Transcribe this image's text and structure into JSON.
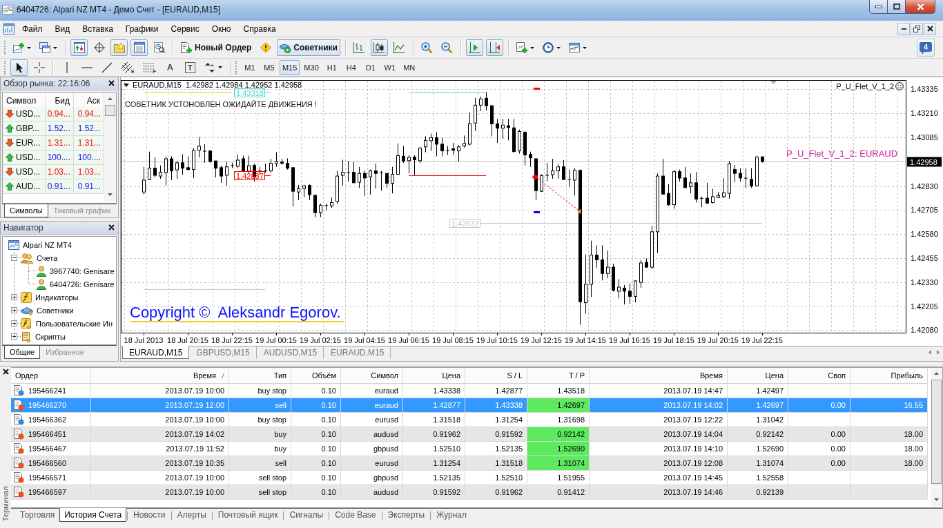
{
  "window": {
    "title": "6404726: Alpari NZ MT4 - Демо Счет - [EURAUD,M15]"
  },
  "menu": [
    "Файл",
    "Вид",
    "Вставка",
    "Графики",
    "Сервис",
    "Окно",
    "Справка"
  ],
  "toolbar": {
    "groups": [
      [
        {
          "kind": "new-chart",
          "pressed": false
        },
        {
          "kind": "profiles",
          "pressed": false
        }
      ],
      [
        {
          "kind": "market-watch",
          "pressed": true
        },
        {
          "kind": "data-window",
          "pressed": false
        },
        {
          "kind": "navigator",
          "pressed": true
        },
        {
          "kind": "terminal",
          "pressed": true
        },
        {
          "kind": "tester",
          "pressed": false
        }
      ],
      [
        {
          "kind": "new-order",
          "label": "Новый Ордер",
          "pressed": false
        },
        {
          "kind": "alert",
          "pressed": false
        },
        {
          "kind": "experts",
          "label": "Советники",
          "pressed": true
        }
      ],
      [
        {
          "kind": "bar-chart",
          "pressed": false
        },
        {
          "kind": "candle-chart",
          "pressed": true
        },
        {
          "kind": "line-chart",
          "pressed": false
        }
      ],
      [
        {
          "kind": "zoom-in",
          "pressed": false
        },
        {
          "kind": "zoom-out",
          "pressed": false
        }
      ],
      [
        {
          "kind": "auto-scroll",
          "pressed": true
        },
        {
          "kind": "chart-shift",
          "pressed": true
        }
      ],
      [
        {
          "kind": "indicators",
          "pressed": false
        },
        {
          "kind": "periods",
          "pressed": false
        },
        {
          "kind": "templates",
          "pressed": false
        }
      ]
    ],
    "notifications": "4"
  },
  "drawing_tools": {
    "groups": [
      [
        {
          "kind": "cursor",
          "pressed": true
        },
        {
          "kind": "crosshair",
          "pressed": false
        }
      ],
      [
        {
          "kind": "vline",
          "pressed": false
        },
        {
          "kind": "hline",
          "pressed": false
        },
        {
          "kind": "trendline",
          "pressed": false
        },
        {
          "kind": "channel",
          "label": "E",
          "pressed": false
        },
        {
          "kind": "fibo",
          "label": "F",
          "pressed": false
        },
        {
          "kind": "text",
          "label": "A",
          "pressed": false
        },
        {
          "kind": "text-label",
          "label": "T",
          "pressed": false
        },
        {
          "kind": "arrows",
          "pressed": false
        }
      ]
    ]
  },
  "timeframes": [
    {
      "label": "M1",
      "selected": false
    },
    {
      "label": "M5",
      "selected": false
    },
    {
      "label": "M15",
      "selected": true
    },
    {
      "label": "M30",
      "selected": false
    },
    {
      "label": "H1",
      "selected": false
    },
    {
      "label": "H4",
      "selected": false
    },
    {
      "label": "D1",
      "selected": false
    },
    {
      "label": "W1",
      "selected": false
    },
    {
      "label": "MN",
      "selected": false
    }
  ],
  "market_watch": {
    "title": "Обзор рынка: 22:16:06",
    "columns": [
      "Символ",
      "Бид",
      "Аск"
    ],
    "rows": [
      {
        "symbol": "USD...",
        "bid": "0.94...",
        "ask": "0.94...",
        "up": false
      },
      {
        "symbol": "GBP...",
        "bid": "1.52...",
        "ask": "1.52...",
        "up": true
      },
      {
        "symbol": "EUR...",
        "bid": "1.31...",
        "ask": "1.31...",
        "up": false
      },
      {
        "symbol": "USD...",
        "bid": "100....",
        "ask": "100....",
        "up": true
      },
      {
        "symbol": "USD...",
        "bid": "1.03...",
        "ask": "1.03...",
        "up": false
      },
      {
        "symbol": "AUD...",
        "bid": "0.91...",
        "ask": "0.91...",
        "up": true
      }
    ],
    "tabs": [
      {
        "label": "Символы",
        "selected": true
      },
      {
        "label": "Тиковый график",
        "selected": false
      }
    ]
  },
  "navigator": {
    "title": "Навигатор",
    "tree": [
      {
        "label": "Alpari NZ MT4",
        "kind": "terminal",
        "children": [
          {
            "label": "Счета",
            "kind": "accounts",
            "expanded": true,
            "children": [
              {
                "label": "3967740: Genisare",
                "kind": "account"
              },
              {
                "label": "6404726: Genisare",
                "kind": "account"
              }
            ]
          },
          {
            "label": "Индикаторы",
            "kind": "indicators",
            "expanded": false
          },
          {
            "label": "Советники",
            "kind": "experts",
            "expanded": false
          },
          {
            "label": "Пользовательские Ин",
            "kind": "custom-indicators",
            "expanded": false
          },
          {
            "label": "Скрипты",
            "kind": "scripts",
            "expanded": false
          }
        ]
      }
    ],
    "tabs": [
      {
        "label": "Общие",
        "selected": true
      },
      {
        "label": "Избранное",
        "selected": false
      }
    ]
  },
  "chart": {
    "header": "EURAUD,M15  1.42982 1.42984 1.42952 1.42958",
    "message": "СОВЕТНИК УСТОНОВЛЕН ОЖИДАЙТЕ ДВИЖЕНИЯ !",
    "expert": "P_U_Flet_V_1_2",
    "symbol_label": "P_U_Flet_V_1_2: EURAUD",
    "copyright": "Copyright ©  Aleksandr Egorov.",
    "chart_data": [
      {
        "type": "candlestick",
        "grid": true,
        "xlim": [
          "2013-07-18T17:15",
          "2013-07-20T04:45"
        ],
        "ylim": [
          1.42067,
          1.43378
        ],
        "x": [
          "2013-07-18T18:15",
          "2013-07-18T18:30",
          "2013-07-18T18:45",
          "2013-07-18T19:00",
          "2013-07-18T19:15",
          "2013-07-18T19:30",
          "2013-07-18T19:45",
          "2013-07-18T20:00",
          "2013-07-18T20:15",
          "2013-07-18T20:30",
          "2013-07-18T20:45",
          "2013-07-18T21:00",
          "2013-07-18T21:15",
          "2013-07-18T21:30",
          "2013-07-18T21:45",
          "2013-07-18T22:00",
          "2013-07-18T22:15",
          "2013-07-18T22:30",
          "2013-07-18T22:45",
          "2013-07-18T23:00",
          "2013-07-18T23:15",
          "2013-07-18T23:30",
          "2013-07-18T23:45",
          "2013-07-19T00:00",
          "2013-07-19T00:15",
          "2013-07-19T00:30",
          "2013-07-19T00:45",
          "2013-07-19T01:00",
          "2013-07-19T01:15",
          "2013-07-19T01:30",
          "2013-07-19T01:45",
          "2013-07-19T02:00",
          "2013-07-19T02:15",
          "2013-07-19T02:30",
          "2013-07-19T02:45",
          "2013-07-19T03:00",
          "2013-07-19T03:15",
          "2013-07-19T03:30",
          "2013-07-19T03:45",
          "2013-07-19T04:00",
          "2013-07-19T04:15",
          "2013-07-19T04:30",
          "2013-07-19T04:45",
          "2013-07-19T05:00",
          "2013-07-19T05:15",
          "2013-07-19T05:30",
          "2013-07-19T05:45",
          "2013-07-19T06:00",
          "2013-07-19T06:15",
          "2013-07-19T06:30",
          "2013-07-19T06:45",
          "2013-07-19T07:00",
          "2013-07-19T07:15",
          "2013-07-19T07:30",
          "2013-07-19T07:45",
          "2013-07-19T08:00",
          "2013-07-19T08:15",
          "2013-07-19T08:30",
          "2013-07-19T08:45",
          "2013-07-19T09:00",
          "2013-07-19T09:15",
          "2013-07-19T09:30",
          "2013-07-19T09:45",
          "2013-07-19T10:00",
          "2013-07-19T10:15",
          "2013-07-19T10:30",
          "2013-07-19T10:45",
          "2013-07-19T11:00",
          "2013-07-19T11:15",
          "2013-07-19T11:30",
          "2013-07-19T11:45",
          "2013-07-19T12:00",
          "2013-07-19T12:15",
          "2013-07-19T12:30",
          "2013-07-19T12:45",
          "2013-07-19T13:00",
          "2013-07-19T13:15",
          "2013-07-19T13:30",
          "2013-07-19T13:45",
          "2013-07-19T14:00",
          "2013-07-19T14:15",
          "2013-07-19T14:30",
          "2013-07-19T14:45",
          "2013-07-19T15:00",
          "2013-07-19T15:15",
          "2013-07-19T15:30",
          "2013-07-19T15:45",
          "2013-07-19T16:00",
          "2013-07-19T16:15",
          "2013-07-19T16:30",
          "2013-07-19T16:45",
          "2013-07-19T17:00",
          "2013-07-19T17:15",
          "2013-07-19T17:30",
          "2013-07-19T17:45",
          "2013-07-19T18:00",
          "2013-07-19T18:15",
          "2013-07-19T18:30",
          "2013-07-19T18:45",
          "2013-07-19T19:00",
          "2013-07-19T19:15",
          "2013-07-19T19:30",
          "2013-07-19T19:45",
          "2013-07-19T20:00",
          "2013-07-19T20:15",
          "2013-07-19T20:30",
          "2013-07-19T20:45",
          "2013-07-19T21:00",
          "2013-07-19T21:15",
          "2013-07-19T21:30",
          "2013-07-19T21:45",
          "2013-07-19T22:00",
          "2013-07-19T22:15"
        ],
        "ohlc": [
          [
            1.42799,
            1.4293,
            1.42785,
            1.42861
          ],
          [
            1.42864,
            1.43009,
            1.42861,
            1.42923
          ],
          [
            1.42923,
            1.42979,
            1.42875,
            1.42886
          ],
          [
            1.42882,
            1.42937,
            1.42868,
            1.42902
          ],
          [
            1.429,
            1.42985,
            1.42833,
            1.42972
          ],
          [
            1.42972,
            1.42985,
            1.42861,
            1.42909
          ],
          [
            1.42914,
            1.42958,
            1.42868,
            1.42951
          ],
          [
            1.42951,
            1.42995,
            1.42889,
            1.42923
          ],
          [
            1.42926,
            1.42985,
            1.42909,
            1.42916
          ],
          [
            1.42916,
            1.43027,
            1.42871,
            1.43017
          ],
          [
            1.43017,
            1.43085,
            1.42979,
            1.43037
          ],
          [
            1.43013,
            1.43048,
            1.42951,
            1.4301
          ],
          [
            1.43013,
            1.43013,
            1.42951,
            1.42958
          ],
          [
            1.42961,
            1.42961,
            1.42875,
            1.42923
          ],
          [
            1.42926,
            1.42937,
            1.42847,
            1.42882
          ],
          [
            1.42886,
            1.42955,
            1.42833,
            1.4293
          ],
          [
            1.42937,
            1.42951,
            1.42923,
            1.42935
          ],
          [
            1.42933,
            1.42995,
            1.42923,
            1.42965
          ],
          [
            1.42972,
            1.42988,
            1.42902,
            1.42909
          ],
          [
            1.42908,
            1.42988,
            1.42896,
            1.42936
          ],
          [
            1.42937,
            1.42947,
            1.42854,
            1.42878
          ],
          [
            1.42909,
            1.4293,
            1.42889,
            1.42907
          ],
          [
            1.42907,
            1.42947,
            1.429,
            1.42909
          ],
          [
            1.42909,
            1.42972,
            1.429,
            1.42948
          ],
          [
            1.42947,
            1.43006,
            1.4293,
            1.42958
          ],
          [
            1.42955,
            1.42972,
            1.42941,
            1.42949
          ],
          [
            1.42948,
            1.42974,
            1.42916,
            1.42923
          ],
          [
            1.42926,
            1.42926,
            1.42723,
            1.42803
          ],
          [
            1.42799,
            1.42836,
            1.42757,
            1.42817
          ],
          [
            1.42817,
            1.42836,
            1.42771,
            1.42831
          ],
          [
            1.42833,
            1.4284,
            1.42757,
            1.42785
          ],
          [
            1.42782,
            1.42782,
            1.42668,
            1.42692
          ],
          [
            1.42692,
            1.42739,
            1.42668,
            1.4273
          ],
          [
            1.42727,
            1.42739,
            1.42702,
            1.4273
          ],
          [
            1.42727,
            1.42771,
            1.42716,
            1.42744
          ],
          [
            1.4275,
            1.42909,
            1.42739,
            1.42882
          ],
          [
            1.42886,
            1.42967,
            1.42833,
            1.42902
          ],
          [
            1.429,
            1.42961,
            1.42854,
            1.42902
          ],
          [
            1.42902,
            1.42955,
            1.42847,
            1.42847
          ],
          [
            1.4285,
            1.4293,
            1.4282,
            1.42896
          ],
          [
            1.42896,
            1.42909,
            1.42778,
            1.42872
          ],
          [
            1.42878,
            1.42916,
            1.42785,
            1.42909
          ],
          [
            1.42909,
            1.42947,
            1.42817,
            1.42896
          ],
          [
            1.429,
            1.42909,
            1.42806,
            1.42898
          ],
          [
            1.42896,
            1.42896,
            1.4282,
            1.42844
          ],
          [
            1.42844,
            1.4293,
            1.42792,
            1.42891
          ],
          [
            1.42891,
            1.43052,
            1.42889,
            1.42988
          ],
          [
            1.42985,
            1.43038,
            1.42951,
            1.42961
          ],
          [
            1.42962,
            1.42992,
            1.42896,
            1.42979
          ],
          [
            1.42981,
            1.4299,
            1.42886,
            1.42967
          ],
          [
            1.42962,
            1.43034,
            1.42951,
            1.43027
          ],
          [
            1.43034,
            1.43089,
            1.43006,
            1.43068
          ],
          [
            1.43066,
            1.43103,
            1.43013,
            1.43082
          ],
          [
            1.43082,
            1.4311,
            1.42985,
            1.43048
          ],
          [
            1.43048,
            1.43082,
            1.42985,
            1.43013
          ],
          [
            1.43017,
            1.43038,
            1.42992,
            1.43015
          ],
          [
            1.43024,
            1.43055,
            1.42992,
            1.43016
          ],
          [
            1.43013,
            1.43043,
            1.42958,
            1.43034
          ],
          [
            1.43038,
            1.43093,
            1.4303,
            1.43052
          ],
          [
            1.43048,
            1.43213,
            1.43041,
            1.43155
          ],
          [
            1.43158,
            1.43289,
            1.43117,
            1.43251
          ],
          [
            1.43251,
            1.43296,
            1.4322,
            1.43283
          ],
          [
            1.43287,
            1.43318,
            1.43223,
            1.43248
          ],
          [
            1.43248,
            1.43251,
            1.43089,
            1.43154
          ],
          [
            1.43154,
            1.43179,
            1.43055,
            1.43131
          ],
          [
            1.43131,
            1.43179,
            1.43075,
            1.43147
          ],
          [
            1.43144,
            1.43179,
            1.43068,
            1.43135
          ],
          [
            1.43133,
            1.43179,
            1.43006,
            1.43009
          ],
          [
            1.43013,
            1.43124,
            1.42999,
            1.43114
          ],
          [
            1.4311,
            1.43117,
            1.42937,
            1.42992
          ],
          [
            1.42995,
            1.43009,
            1.4293,
            1.42977
          ],
          [
            1.42972,
            1.42974,
            1.42757,
            1.42806
          ],
          [
            1.42803,
            1.42891,
            1.42799,
            1.42885
          ],
          [
            1.42885,
            1.42951,
            1.42854,
            1.42887
          ],
          [
            1.42889,
            1.42972,
            1.42868,
            1.42909
          ],
          [
            1.42909,
            1.42944,
            1.42868,
            1.4293
          ],
          [
            1.4293,
            1.42965,
            1.42861,
            1.42864
          ],
          [
            1.42864,
            1.42916,
            1.42827,
            1.42866
          ],
          [
            1.42861,
            1.42923,
            1.42781,
            1.42912
          ],
          [
            1.42912,
            1.42916,
            1.42108,
            1.42228
          ],
          [
            1.42223,
            1.42474,
            1.42166,
            1.42319
          ],
          [
            1.42319,
            1.42546,
            1.42253,
            1.42471
          ],
          [
            1.42471,
            1.42522,
            1.42405,
            1.42446
          ],
          [
            1.42446,
            1.42522,
            1.42339,
            1.42375
          ],
          [
            1.42375,
            1.42495,
            1.4235,
            1.42408
          ],
          [
            1.42408,
            1.42426,
            1.42281,
            1.42288
          ],
          [
            1.42283,
            1.42346,
            1.42246,
            1.42304
          ],
          [
            1.42299,
            1.42315,
            1.42214,
            1.42283
          ],
          [
            1.42283,
            1.42322,
            1.42218,
            1.42256
          ],
          [
            1.42256,
            1.42339,
            1.42225,
            1.42336
          ],
          [
            1.42329,
            1.42446,
            1.42301,
            1.4243
          ],
          [
            1.42433,
            1.42453,
            1.42405,
            1.42408
          ],
          [
            1.42408,
            1.42623,
            1.42398,
            1.42592
          ],
          [
            1.42592,
            1.42896,
            1.42481,
            1.42882
          ],
          [
            1.42882,
            1.42972,
            1.42788,
            1.42788
          ],
          [
            1.42792,
            1.4284,
            1.42727,
            1.42733
          ],
          [
            1.42733,
            1.42914,
            1.42712,
            1.42905
          ],
          [
            1.42905,
            1.42916,
            1.42854,
            1.42872
          ],
          [
            1.42872,
            1.4293,
            1.4282,
            1.42822
          ],
          [
            1.42827,
            1.42896,
            1.42792,
            1.42847
          ],
          [
            1.42847,
            1.42902,
            1.42744,
            1.42762
          ],
          [
            1.42767,
            1.42775,
            1.4272,
            1.42765
          ],
          [
            1.42767,
            1.42847,
            1.42737,
            1.42741
          ],
          [
            1.42744,
            1.42815,
            1.42739,
            1.42775
          ],
          [
            1.42771,
            1.42799,
            1.42767,
            1.42781
          ],
          [
            1.42775,
            1.42872,
            1.42767,
            1.42795
          ],
          [
            1.42792,
            1.42961,
            1.42764,
            1.42947
          ],
          [
            1.42916,
            1.4294,
            1.4285,
            1.42896
          ],
          [
            1.42896,
            1.42923,
            1.42854,
            1.42872
          ],
          [
            1.42872,
            1.42923,
            1.4282,
            1.4287
          ],
          [
            1.42865,
            1.42923,
            1.4282,
            1.42831
          ],
          [
            1.42831,
            1.42988,
            1.42831,
            1.42981
          ],
          [
            1.42982,
            1.42984,
            1.42952,
            1.42958
          ]
        ],
        "xticks": [
          {
            "value": "2013-07-18T18:15",
            "label": "18 Jul 2013"
          },
          {
            "value": "2013-07-18T20:15",
            "label": "18 Jul 20:15"
          },
          {
            "value": "2013-07-18T22:15",
            "label": "18 Jul 22:15"
          },
          {
            "value": "2013-07-19T00:15",
            "label": "19 Jul 00:15"
          },
          {
            "value": "2013-07-19T02:15",
            "label": "19 Jul 02:15"
          },
          {
            "value": "2013-07-19T04:15",
            "label": "19 Jul 04:15"
          },
          {
            "value": "2013-07-19T06:15",
            "label": "19 Jul 06:15"
          },
          {
            "value": "2013-07-19T08:15",
            "label": "19 Jul 08:15"
          },
          {
            "value": "2013-07-19T10:15",
            "label": "19 Jul 10:15"
          },
          {
            "value": "2013-07-19T12:15",
            "label": "19 Jul 12:15"
          },
          {
            "value": "2013-07-19T14:15",
            "label": "19 Jul 14:15"
          },
          {
            "value": "2013-07-19T16:15",
            "label": "19 Jul 16:15"
          },
          {
            "value": "2013-07-19T18:15",
            "label": "19 Jul 18:15"
          },
          {
            "value": "2013-07-19T20:15",
            "label": "19 Jul 20:15"
          },
          {
            "value": "2013-07-19T22:15",
            "label": "19 Jul 22:15"
          }
        ],
        "yticks": [
          {
            "value": 1.43335,
            "label": "1.43335"
          },
          {
            "value": 1.4321,
            "label": "1.43210"
          },
          {
            "value": 1.43085,
            "label": "1.43085"
          },
          {
            "value": 1.4283,
            "label": "1.42830"
          },
          {
            "value": 1.42705,
            "label": "1.42705"
          },
          {
            "value": 1.4258,
            "label": "1.42580"
          },
          {
            "value": 1.42455,
            "label": "1.42455"
          },
          {
            "value": 1.4233,
            "label": "1.42330"
          },
          {
            "value": 1.42205,
            "label": "1.42205"
          },
          {
            "value": 1.4208,
            "label": "1.42080"
          }
        ],
        "series": [
          {
            "type": "line",
            "x": [
              "2013-07-18T18:15",
              "2013-07-18T22:15"
            ],
            "values": [
              1.43318,
              1.43318
            ],
            "color": "#e8c800"
          },
          {
            "name": "1.43318",
            "type": "line",
            "x": [
              "2013-07-18T23:45",
              "2013-07-19T00:00"
            ],
            "values": [
              1.43318,
              1.43318
            ],
            "color": "#48d8d0"
          },
          {
            "type": "line",
            "x": [
              "2013-07-19T06:15",
              "2013-07-19T09:45"
            ],
            "values": [
              1.43318,
              1.43318
            ],
            "color": "#48d8d0"
          },
          {
            "name": "1.42887",
            "type": "line",
            "x": [
              "2013-07-18T23:45",
              "2013-07-19T00:00"
            ],
            "values": [
              1.42887,
              1.42887
            ],
            "color": "#ff0000"
          },
          {
            "type": "line",
            "x": [
              "2013-07-19T06:15",
              "2013-07-19T09:45"
            ],
            "values": [
              1.42887,
              1.42887
            ],
            "color": "#ff0000"
          },
          {
            "type": "line",
            "x": [
              "2013-07-18T18:15",
              "2013-07-18T23:45"
            ],
            "values": [
              1.42293,
              1.42293
            ],
            "color": "#c8c8c8"
          },
          {
            "name": "1.42637",
            "type": "line",
            "x": [
              "2013-07-19T09:30",
              "2013-07-19T22:15"
            ],
            "values": [
              1.42637,
              1.42637
            ],
            "color": "#c4c4c4"
          },
          {
            "type": "line",
            "line_style": "dashed",
            "marker": "triangle",
            "x": [
              "2013-07-19T12:00",
              "2013-07-19T14:00"
            ],
            "values": [
              1.42877,
              1.42697
            ],
            "color": "#ff0000"
          },
          {
            "type": "scatter",
            "marker": "square",
            "x": [
              "2013-07-19T12:00"
            ],
            "values": [
              1.43338
            ],
            "color": "#ff0000"
          },
          {
            "type": "scatter",
            "marker": "square",
            "x": [
              "2013-07-19T12:00"
            ],
            "values": [
              1.42697
            ],
            "color": "#0000ff"
          }
        ],
        "ref_lines": [
          {
            "axis": "y",
            "value": 1.42958,
            "label": "1.42958",
            "color": "#c0c0c0"
          }
        ]
      }
    ],
    "tabs": [
      {
        "label": "EURAUD,M15",
        "selected": true
      },
      {
        "label": "GBPUSD,M15",
        "selected": false
      },
      {
        "label": "AUDUSD,M15",
        "selected": false
      },
      {
        "label": "EURAUD,M15",
        "selected": false
      }
    ]
  },
  "terminal": {
    "title": "Терминал",
    "columns": [
      {
        "label": "Ордер",
        "sorted": false
      },
      {
        "label": "Время",
        "sorted": true
      },
      {
        "label": "Тип",
        "sorted": false
      },
      {
        "label": "Объём",
        "sorted": false
      },
      {
        "label": "Символ",
        "sorted": false
      },
      {
        "label": "Цена",
        "sorted": false
      },
      {
        "label": "S / L",
        "sorted": false
      },
      {
        "label": "T / P",
        "sorted": false
      },
      {
        "label": "Время",
        "sorted": false
      },
      {
        "label": "Цена",
        "sorted": false
      },
      {
        "label": "Своп",
        "sorted": false
      },
      {
        "label": "Прибыль",
        "sorted": false
      }
    ],
    "rows": [
      {
        "order": "195466241",
        "open_time": "2013.07.19 10:00",
        "type": "buy stop",
        "size": "0.10",
        "symbol": "euraud",
        "price": "1.43338",
        "sl": "1.42877",
        "tp": "1.43518",
        "close_time": "2013.07.19 14:47",
        "close_price": "1.42497",
        "color": "#2f86e0",
        "selected": false,
        "tp_hit": false
      },
      {
        "order": "195466270",
        "open_time": "2013.07.19 12:00",
        "type": "sell",
        "size": "0.10",
        "symbol": "euraud",
        "price": "1.42877",
        "sl": "1.43338",
        "tp": "1.42697",
        "close_time": "2013.07.19 14:02",
        "close_price": "1.42697",
        "swap": "0.00",
        "profit": "16.55",
        "color": "#e8501c",
        "selected": true,
        "tp_hit": true
      },
      {
        "order": "195466362",
        "open_time": "2013.07.19 10:00",
        "type": "buy stop",
        "size": "0.10",
        "symbol": "eurusd",
        "price": "1.31518",
        "sl": "1.31254",
        "tp": "1.31698",
        "close_time": "2013.07.19 12:22",
        "close_price": "1.31042",
        "color": "#2f86e0",
        "selected": false,
        "tp_hit": false
      },
      {
        "order": "195466451",
        "open_time": "2013.07.19 14:02",
        "type": "buy",
        "size": "0.10",
        "symbol": "audusd",
        "price": "0.91962",
        "sl": "0.91592",
        "tp": "0.92142",
        "close_time": "2013.07.19 14:04",
        "close_price": "0.92142",
        "swap": "0.00",
        "profit": "18.00",
        "color": "#e8501c",
        "selected": false,
        "tp_hit": true
      },
      {
        "order": "195466467",
        "open_time": "2013.07.19 11:52",
        "type": "buy",
        "size": "0.10",
        "symbol": "gbpusd",
        "price": "1.52510",
        "sl": "1.52135",
        "tp": "1.52690",
        "close_time": "2013.07.19 14:10",
        "close_price": "1.52690",
        "swap": "0.00",
        "profit": "18.00",
        "color": "#e8501c",
        "selected": false,
        "tp_hit": true
      },
      {
        "order": "195466560",
        "open_time": "2013.07.19 10:35",
        "type": "sell",
        "size": "0.10",
        "symbol": "eurusd",
        "price": "1.31254",
        "sl": "1.31518",
        "tp": "1.31074",
        "close_time": "2013.07.19 12:08",
        "close_price": "1.31074",
        "swap": "0.00",
        "profit": "18.00",
        "color": "#e8501c",
        "selected": false,
        "tp_hit": true
      },
      {
        "order": "195466571",
        "open_time": "2013.07.19 10:00",
        "type": "sell stop",
        "size": "0.10",
        "symbol": "gbpusd",
        "price": "1.52135",
        "sl": "1.52510",
        "tp": "1.51955",
        "close_time": "2013.07.19 14:45",
        "close_price": "1.52558",
        "color": "#e8501c",
        "selected": false,
        "tp_hit": false
      },
      {
        "order": "195466597",
        "open_time": "2013.07.19 10:00",
        "type": "sell stop",
        "size": "0.10",
        "symbol": "audusd",
        "price": "0.91592",
        "sl": "0.91962",
        "tp": "0.91412",
        "close_time": "2013.07.19 14:46",
        "close_price": "0.92139",
        "color": "#e8501c",
        "selected": false,
        "tp_hit": false
      }
    ],
    "tabs": [
      {
        "label": "Торговля",
        "selected": false
      },
      {
        "label": "История Счета",
        "selected": true
      },
      {
        "label": "Новости",
        "selected": false
      },
      {
        "label": "Алерты",
        "selected": false
      },
      {
        "label": "Почтовый ящик",
        "selected": false
      },
      {
        "label": "Сигналы",
        "selected": false
      },
      {
        "label": "Code Base",
        "selected": false
      },
      {
        "label": "Эксперты",
        "selected": false
      },
      {
        "label": "Журнал",
        "selected": false
      }
    ]
  }
}
